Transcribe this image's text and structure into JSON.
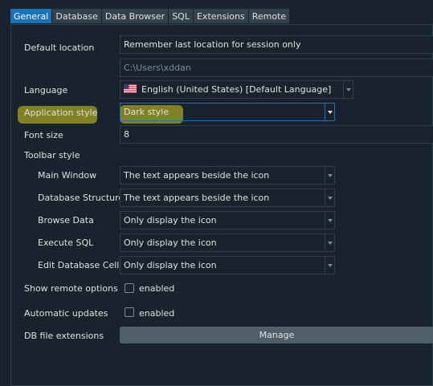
{
  "tabs": [
    "General",
    "Database",
    "Data Browser",
    "SQL",
    "Extensions",
    "Remote"
  ],
  "general": {
    "default_location_label": "Default location",
    "default_location_value": "Remember last location for session only",
    "default_location_path": "C:\\Users\\xddan",
    "language_label": "Language",
    "language_value": "English (United States) [Default Language]",
    "application_style_label": "Application style",
    "application_style_value": "Dark style",
    "font_size_label": "Font size",
    "font_size_value": "8",
    "toolbar_style_label": "Toolbar style",
    "toolbar_rows": [
      {
        "label": "Main Window",
        "value": "The text appears beside the icon"
      },
      {
        "label": "Database Structure",
        "value": "The text appears beside the icon"
      },
      {
        "label": "Browse Data",
        "value": "Only display the icon"
      },
      {
        "label": "Execute SQL",
        "value": "Only display the icon"
      },
      {
        "label": "Edit Database Cell",
        "value": "Only display the icon"
      }
    ],
    "show_remote_label": "Show remote options",
    "show_remote_check": "enabled",
    "auto_updates_label": "Automatic updates",
    "auto_updates_check": "enabled",
    "db_ext_label": "DB file extensions",
    "manage_button": "Manage"
  },
  "colors": {
    "background": "#19232d",
    "border": "#32414b",
    "accent": "#1a72bb",
    "highlight": "#d6d01b",
    "text": "#dfe1e2"
  },
  "icons": {
    "language_flag": "us-flag-icon"
  }
}
